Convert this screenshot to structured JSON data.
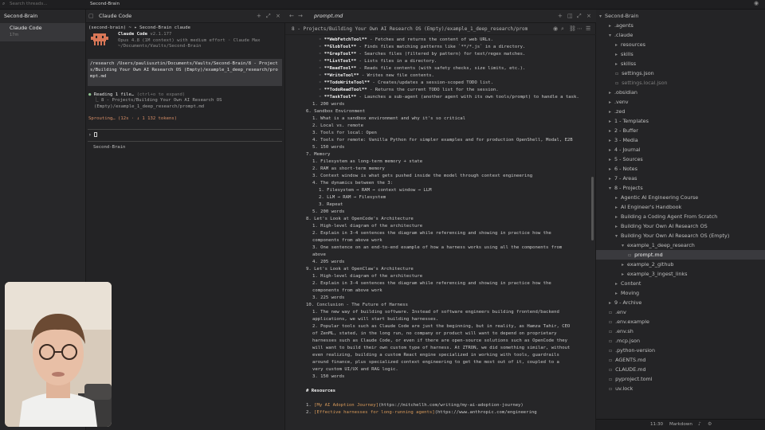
{
  "topbar": {
    "search_placeholder": "Search threads...",
    "vault_title": "Second-Brain"
  },
  "threads": {
    "header": "Second-Brain",
    "items": [
      {
        "title": "Claude Code",
        "meta": "17m"
      }
    ]
  },
  "terminal": {
    "tab_title": "Claude Code",
    "prompt_line": "(second-brain) ~ ✦ Second-Brain claude",
    "app_name": "Claude Code",
    "version": "v2.1.177",
    "model_line": "Opus 4.8 (1M context) with medium effort · Claude Max",
    "cwd": "~/Documents/Vaults/Second-Brain",
    "command": "/research /Users/pauliusztin/Documents/Vaults/Second-Brain/8 - Projects/Building Your Own AI Research OS (Empty)/example_1_deep_research/prompt.md",
    "reading_label": "Reading 1 file…",
    "reading_hint": "(ctrl+o to expand)",
    "reading_path": "8 - Projects/Building Your Own AI Research OS (Empty)/example_1_deep_research/prompt.md",
    "status": "Sprouting… (12s · ↓ 1 132 tokens)",
    "input_prompt": "›",
    "footer_label": "Second-Brain"
  },
  "editor": {
    "tab_title": "prompt.md",
    "breadcrumb": "8 - Projects/Building Your Own AI Research OS (Empty)/example_1_deep_research/prom",
    "lines": [
      {
        "n": "",
        "indent": 4,
        "parts": [
          {
            "t": "◦ "
          },
          {
            "t": "**WebFetchTool**",
            "b": 1
          },
          {
            "t": " - Fetches and returns the content of web URLs."
          }
        ]
      },
      {
        "n": "",
        "indent": 4,
        "parts": [
          {
            "t": "◦ "
          },
          {
            "t": "**GlobTool**",
            "b": 1
          },
          {
            "t": " - Finds files matching patterns like `**/*.js` in a directory."
          }
        ]
      },
      {
        "n": "",
        "indent": 4,
        "parts": [
          {
            "t": "◦ "
          },
          {
            "t": "**GrepTool**",
            "b": 1
          },
          {
            "t": " - Searches files (filtered by pattern) for text/regex matches."
          }
        ]
      },
      {
        "n": "",
        "indent": 4,
        "parts": [
          {
            "t": "◦ "
          },
          {
            "t": "**ListTool**",
            "b": 1
          },
          {
            "t": " - Lists files in a directory."
          }
        ]
      },
      {
        "n": "",
        "indent": 4,
        "parts": [
          {
            "t": "◦ "
          },
          {
            "t": "**ReadTool**",
            "b": 1
          },
          {
            "t": " - Reads file contents (with safety checks, size limits, etc.)."
          }
        ]
      },
      {
        "n": "",
        "indent": 4,
        "parts": [
          {
            "t": "◦ "
          },
          {
            "t": "**WriteTool**",
            "b": 1
          },
          {
            "t": " - Writes new file contents."
          }
        ]
      },
      {
        "n": "",
        "indent": 4,
        "parts": [
          {
            "t": "◦ "
          },
          {
            "t": "**TodoWriteTool**",
            "b": 1
          },
          {
            "t": " - Creates/updates a session-scoped TODO list."
          }
        ]
      },
      {
        "n": "",
        "indent": 4,
        "parts": [
          {
            "t": "◦ "
          },
          {
            "t": "**TodoReadTool**",
            "b": 1
          },
          {
            "t": " - Returns the current TODO list for the session."
          }
        ]
      },
      {
        "n": "",
        "indent": 4,
        "parts": [
          {
            "t": "◦ "
          },
          {
            "t": "**TaskTool**",
            "b": 1
          },
          {
            "t": " - Launches a sub-agent (another agent with its own tools/prompt) to handle a task."
          }
        ]
      },
      {
        "n": "",
        "indent": 2,
        "parts": [
          {
            "t": "1. 200 words"
          }
        ]
      },
      {
        "n": "",
        "indent": 0,
        "parts": [
          {
            "t": "6. Sandbox Environment"
          }
        ]
      },
      {
        "n": "",
        "indent": 2,
        "parts": [
          {
            "t": "1. What is a sandbox environment and why it's so critical"
          }
        ]
      },
      {
        "n": "",
        "indent": 2,
        "parts": [
          {
            "t": "2. Local vs. remote"
          }
        ]
      },
      {
        "n": "",
        "indent": 2,
        "parts": [
          {
            "t": "3. Tools for local: Open"
          }
        ]
      },
      {
        "n": "",
        "indent": 2,
        "parts": [
          {
            "t": "4. Tools for remote: Vanilla Python for simpler examples and for production OpenShell, Modal, E2B"
          }
        ]
      },
      {
        "n": "",
        "indent": 2,
        "parts": [
          {
            "t": "5. 150 words"
          }
        ]
      },
      {
        "n": "",
        "indent": 0,
        "parts": [
          {
            "t": "7. Memory"
          }
        ]
      },
      {
        "n": "",
        "indent": 2,
        "parts": [
          {
            "t": "1. Filesystem as long-term memory + state"
          }
        ]
      },
      {
        "n": "",
        "indent": 2,
        "parts": [
          {
            "t": "2. RAM as short-term memory"
          }
        ]
      },
      {
        "n": "",
        "indent": 2,
        "parts": [
          {
            "t": "3. Context window is what gets pushed inside the model through context engineering"
          }
        ]
      },
      {
        "n": "",
        "indent": 2,
        "parts": [
          {
            "t": "4. The dynamics between the 3:"
          }
        ]
      },
      {
        "n": "",
        "indent": 4,
        "parts": [
          {
            "t": "1. Filesystem → RAM → context window → LLM"
          }
        ]
      },
      {
        "n": "",
        "indent": 4,
        "parts": [
          {
            "t": "2. LLM → RAM → Filesystem"
          }
        ]
      },
      {
        "n": "",
        "indent": 4,
        "parts": [
          {
            "t": "3. Repeat"
          }
        ]
      },
      {
        "n": "",
        "indent": 2,
        "parts": [
          {
            "t": "5. 200 words"
          }
        ]
      },
      {
        "n": "",
        "indent": 0,
        "parts": [
          {
            "t": "8. Let's Look at OpenCode's Architecture"
          }
        ]
      },
      {
        "n": "",
        "indent": 2,
        "parts": [
          {
            "t": "1. High-level diagram of the architecture"
          }
        ]
      },
      {
        "n": "",
        "indent": 2,
        "parts": [
          {
            "t": "2. Explain in 3-4 sentences the diagram while referencing and showing in practice how the"
          }
        ]
      },
      {
        "n": "",
        "indent": 2,
        "parts": [
          {
            "t": "components from above work"
          }
        ]
      },
      {
        "n": "",
        "indent": 2,
        "parts": [
          {
            "t": "3. One sentence on an end-to-end example of how a harness works using all the components from"
          }
        ]
      },
      {
        "n": "",
        "indent": 2,
        "parts": [
          {
            "t": "above"
          }
        ]
      },
      {
        "n": "",
        "indent": 2,
        "parts": [
          {
            "t": "4. 205 words"
          }
        ]
      },
      {
        "n": "",
        "indent": 0,
        "parts": [
          {
            "t": "9. Let's Look at OpenClaw's Architecture"
          }
        ]
      },
      {
        "n": "",
        "indent": 2,
        "parts": [
          {
            "t": "1. High-level diagram of the architecture"
          }
        ]
      },
      {
        "n": "",
        "indent": 2,
        "parts": [
          {
            "t": "2. Explain in 3-4 sentences the diagram while referencing and showing in practice how the"
          }
        ]
      },
      {
        "n": "",
        "indent": 2,
        "parts": [
          {
            "t": "components from above work"
          }
        ]
      },
      {
        "n": "",
        "indent": 2,
        "parts": [
          {
            "t": "3. 225 words"
          }
        ]
      },
      {
        "n": "",
        "indent": 0,
        "parts": [
          {
            "t": "10. Conclusion - The Future of Harness"
          }
        ]
      },
      {
        "n": "",
        "indent": 2,
        "parts": [
          {
            "t": "1. The new way of building software. Instead of software engineers building frontend/backend"
          }
        ]
      },
      {
        "n": "",
        "indent": 2,
        "parts": [
          {
            "t": "applications, we will start building harnesses."
          }
        ]
      },
      {
        "n": "",
        "indent": 2,
        "parts": [
          {
            "t": "2. Popular tools such as Claude Code are just the beginning, but in reality, as Hamza Tahir, CEO"
          }
        ]
      },
      {
        "n": "",
        "indent": 2,
        "parts": [
          {
            "t": "of ZenML, stated, in the long run, no company or product will want to depend on proprietary"
          }
        ]
      },
      {
        "n": "",
        "indent": 2,
        "parts": [
          {
            "t": "harnesses such as Claude Code, or even if there are open-source solutions such as OpenCode they"
          }
        ]
      },
      {
        "n": "",
        "indent": 2,
        "parts": [
          {
            "t": "will want to build their own custom type of harness. At ZTRON, we did something similar, without"
          }
        ]
      },
      {
        "n": "",
        "indent": 2,
        "parts": [
          {
            "t": "even realizing, building a custom React engine specialized in working with tools, guardrails"
          }
        ]
      },
      {
        "n": "",
        "indent": 2,
        "parts": [
          {
            "t": "around finance, plus specialized context engineering to get the most out of it, coupled to a"
          }
        ]
      },
      {
        "n": "",
        "indent": 2,
        "parts": [
          {
            "t": "very custom UI/UX and RAG logic."
          }
        ]
      },
      {
        "n": "",
        "indent": 2,
        "parts": [
          {
            "t": "3. 150 words"
          }
        ]
      },
      {
        "n": "",
        "indent": 0,
        "parts": [
          {
            "t": ""
          }
        ]
      },
      {
        "n": "",
        "indent": 0,
        "parts": [
          {
            "t": "# Resources",
            "b": 1
          }
        ]
      },
      {
        "n": "",
        "indent": 0,
        "parts": [
          {
            "t": ""
          }
        ]
      },
      {
        "n": "",
        "indent": 0,
        "parts": [
          {
            "t": "1. "
          },
          {
            "t": "[My AI Adoption Journey]",
            "l": 1
          },
          {
            "t": "(https://mitchellh.com/writing/my-ai-adoption-journey)"
          }
        ]
      },
      {
        "n": "",
        "indent": 0,
        "parts": [
          {
            "t": "2. "
          },
          {
            "t": "[Effective harnesses for long-running agents]",
            "l": 1
          },
          {
            "t": "(https://www.anthropic.com/engineering"
          }
        ]
      }
    ]
  },
  "tree": {
    "root": "Second-Brain",
    "items": [
      {
        "label": ".agents",
        "depth": 0,
        "kind": "folder"
      },
      {
        "label": ".claude",
        "depth": 0,
        "kind": "folder-open"
      },
      {
        "label": "resources",
        "depth": 1,
        "kind": "folder"
      },
      {
        "label": "skills",
        "depth": 1,
        "kind": "folder"
      },
      {
        "label": "skillss",
        "depth": 1,
        "kind": "folder"
      },
      {
        "label": "settings.json",
        "depth": 1,
        "kind": "file"
      },
      {
        "label": "settings.local.json",
        "depth": 1,
        "kind": "file-dim"
      },
      {
        "label": ".obsidian",
        "depth": 0,
        "kind": "folder"
      },
      {
        "label": ".venv",
        "depth": 0,
        "kind": "folder"
      },
      {
        "label": ".zed",
        "depth": 0,
        "kind": "folder"
      },
      {
        "label": "1 - Templates",
        "depth": 0,
        "kind": "folder"
      },
      {
        "label": "2 - Buffer",
        "depth": 0,
        "kind": "folder"
      },
      {
        "label": "3 - Media",
        "depth": 0,
        "kind": "folder"
      },
      {
        "label": "4 - Journal",
        "depth": 0,
        "kind": "folder"
      },
      {
        "label": "5 - Sources",
        "depth": 0,
        "kind": "folder"
      },
      {
        "label": "6 - Notes",
        "depth": 0,
        "kind": "folder"
      },
      {
        "label": "7 - Areas",
        "depth": 0,
        "kind": "folder"
      },
      {
        "label": "8 - Projects",
        "depth": 0,
        "kind": "folder-open"
      },
      {
        "label": "Agentic AI Engineering Course",
        "depth": 1,
        "kind": "folder"
      },
      {
        "label": "AI Engineer's Handbook",
        "depth": 1,
        "kind": "folder"
      },
      {
        "label": "Building a Coding Agent From Scratch",
        "depth": 1,
        "kind": "folder"
      },
      {
        "label": "Building Your Own AI Research OS",
        "depth": 1,
        "kind": "folder"
      },
      {
        "label": "Building Your Own AI Research OS (Empty)",
        "depth": 1,
        "kind": "folder-open"
      },
      {
        "label": "example_1_deep_research",
        "depth": 2,
        "kind": "folder-open"
      },
      {
        "label": "prompt.md",
        "depth": 3,
        "kind": "file-active"
      },
      {
        "label": "example_2_github",
        "depth": 2,
        "kind": "folder"
      },
      {
        "label": "example_3_ingest_links",
        "depth": 2,
        "kind": "folder"
      },
      {
        "label": "Content",
        "depth": 1,
        "kind": "folder"
      },
      {
        "label": "Moving",
        "depth": 1,
        "kind": "folder"
      },
      {
        "label": "9 - Archive",
        "depth": 0,
        "kind": "folder"
      },
      {
        "label": ".env",
        "depth": 0,
        "kind": "file"
      },
      {
        "label": ".env.example",
        "depth": 0,
        "kind": "file"
      },
      {
        "label": ".env.sh",
        "depth": 0,
        "kind": "file"
      },
      {
        "label": ".mcp.json",
        "depth": 0,
        "kind": "file"
      },
      {
        "label": ".python-version",
        "depth": 0,
        "kind": "file"
      },
      {
        "label": "AGENTS.md",
        "depth": 0,
        "kind": "file"
      },
      {
        "label": "CLAUDE.md",
        "depth": 0,
        "kind": "file"
      },
      {
        "label": "pyproject.toml",
        "depth": 0,
        "kind": "file"
      },
      {
        "label": "uv.lock",
        "depth": 0,
        "kind": "file"
      }
    ]
  },
  "status": {
    "position": "11:30",
    "language": "Markdown"
  }
}
